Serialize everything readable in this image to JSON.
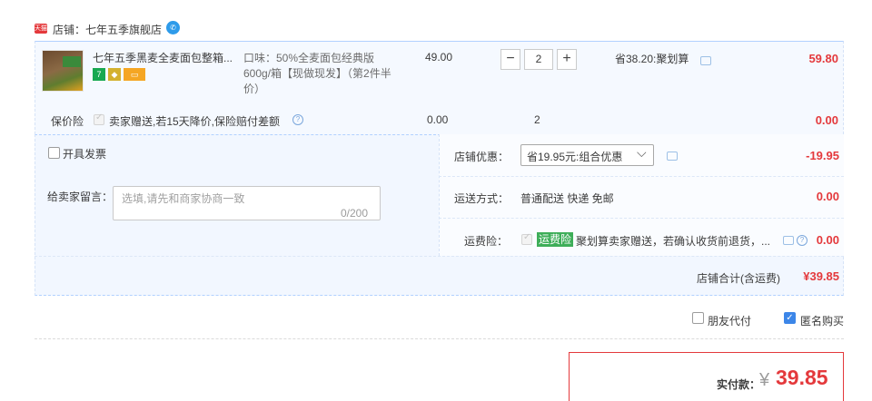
{
  "shop": {
    "badge": "天猫",
    "label": "店铺：七年五季旗舰店",
    "wangwang_icon": "wangwang-chat-icon"
  },
  "item": {
    "title": "七年五季黑麦全麦面包整箱...",
    "sku": "口味：50%全麦面包经典版 600g/箱【现做现发】（第2件半价）",
    "unit_price": "49.00",
    "quantity": "2",
    "minus_label": "−",
    "plus_label": "+",
    "saving": "省38.20:聚划算",
    "subtotal": "59.80",
    "tags": [
      "7",
      "shield",
      "card"
    ]
  },
  "insurance": {
    "label": "保价险",
    "text": "卖家赠送,若15天降价,保险赔付差额",
    "price": "0.00",
    "qty": "2",
    "subtotal": "0.00"
  },
  "invoice": {
    "label": "开具发票",
    "checked": false
  },
  "message": {
    "label": "给卖家留言：",
    "placeholder": "选填,请先和商家协商一致",
    "count": "0/200"
  },
  "discount": {
    "label": "店铺优惠：",
    "selected": "省19.95元:组合优惠",
    "amount": "-19.95"
  },
  "shipping": {
    "label": "运送方式：",
    "method": "普通配送 快递 免邮",
    "amount": "0.00"
  },
  "shipping_insurance": {
    "label": "运费险：",
    "badge": "运费险",
    "text": "聚划算卖家赠送，若确认收货前退货，...",
    "amount": "0.00"
  },
  "shop_total": {
    "label": "店铺合计(含运费)",
    "amount": "¥39.85"
  },
  "options": {
    "friend_pay": "朋友代付",
    "friend_checked": false,
    "anonymous": "匿名购买",
    "anonymous_checked": true
  },
  "payment": {
    "label": "实付款：",
    "currency": "¥",
    "amount": "39.85"
  },
  "colors": {
    "accent_red": "#e4393c",
    "link_blue": "#3c86e8",
    "badge_green": "#3eae59"
  }
}
